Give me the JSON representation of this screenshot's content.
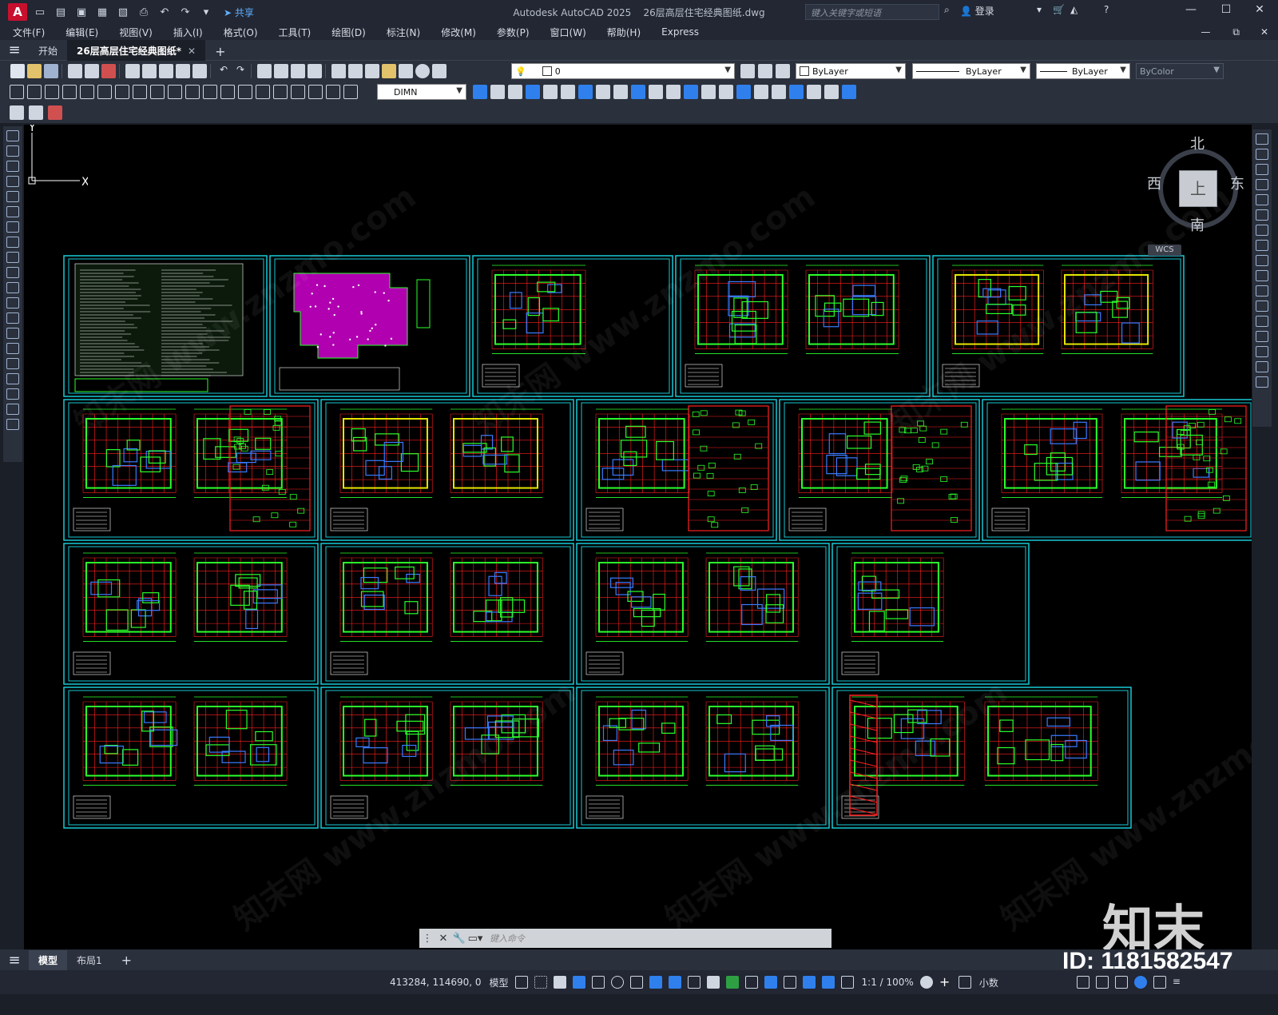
{
  "app": {
    "title": "Autodesk AutoCAD 2025",
    "document_name": "26层高层住宅经典图纸.dwg",
    "logo_letter": "A",
    "share_label": "共享",
    "search_placeholder": "键入关键字或短语",
    "login_label": "登录"
  },
  "menu": [
    "文件(F)",
    "编辑(E)",
    "视图(V)",
    "插入(I)",
    "格式(O)",
    "工具(T)",
    "绘图(D)",
    "标注(N)",
    "修改(M)",
    "参数(P)",
    "窗口(W)",
    "帮助(H)",
    "Express"
  ],
  "tabs": {
    "start": "开始",
    "active": "26层高层住宅经典图纸*",
    "add": "+"
  },
  "toolbar": {
    "layer_value": "0",
    "color_value": "ByLayer",
    "linetype_value": "ByLayer",
    "lineweight_value": "ByLayer",
    "plotstyle_value": "ByColor",
    "dimstyle_value": "DIMN"
  },
  "viewcube": {
    "north": "北",
    "south": "南",
    "east": "东",
    "west": "西",
    "face": "上",
    "wcs": "WCS"
  },
  "ucs": {
    "x_label": "X",
    "y_label": "Y"
  },
  "command": {
    "placeholder": "键入命令"
  },
  "watermark": {
    "text": "知末网 www.znzmo.com",
    "logo": "知末",
    "id": "ID: 1181582547"
  },
  "layout_tabs": {
    "model": "模型",
    "layout1": "布局1",
    "add": "+"
  },
  "status": {
    "coordinates": "413284, 114690, 0",
    "model_label": "模型",
    "scale": "1:1 / 100%",
    "units": "小数"
  },
  "drawing": {
    "colors": {
      "frame": "#19c9d6",
      "lines": "#2bff2b",
      "axis": "#ff2020",
      "walls": "#e6e600",
      "slab": "#b000b0",
      "text": "#ffffff",
      "blue": "#3a7bff"
    }
  }
}
